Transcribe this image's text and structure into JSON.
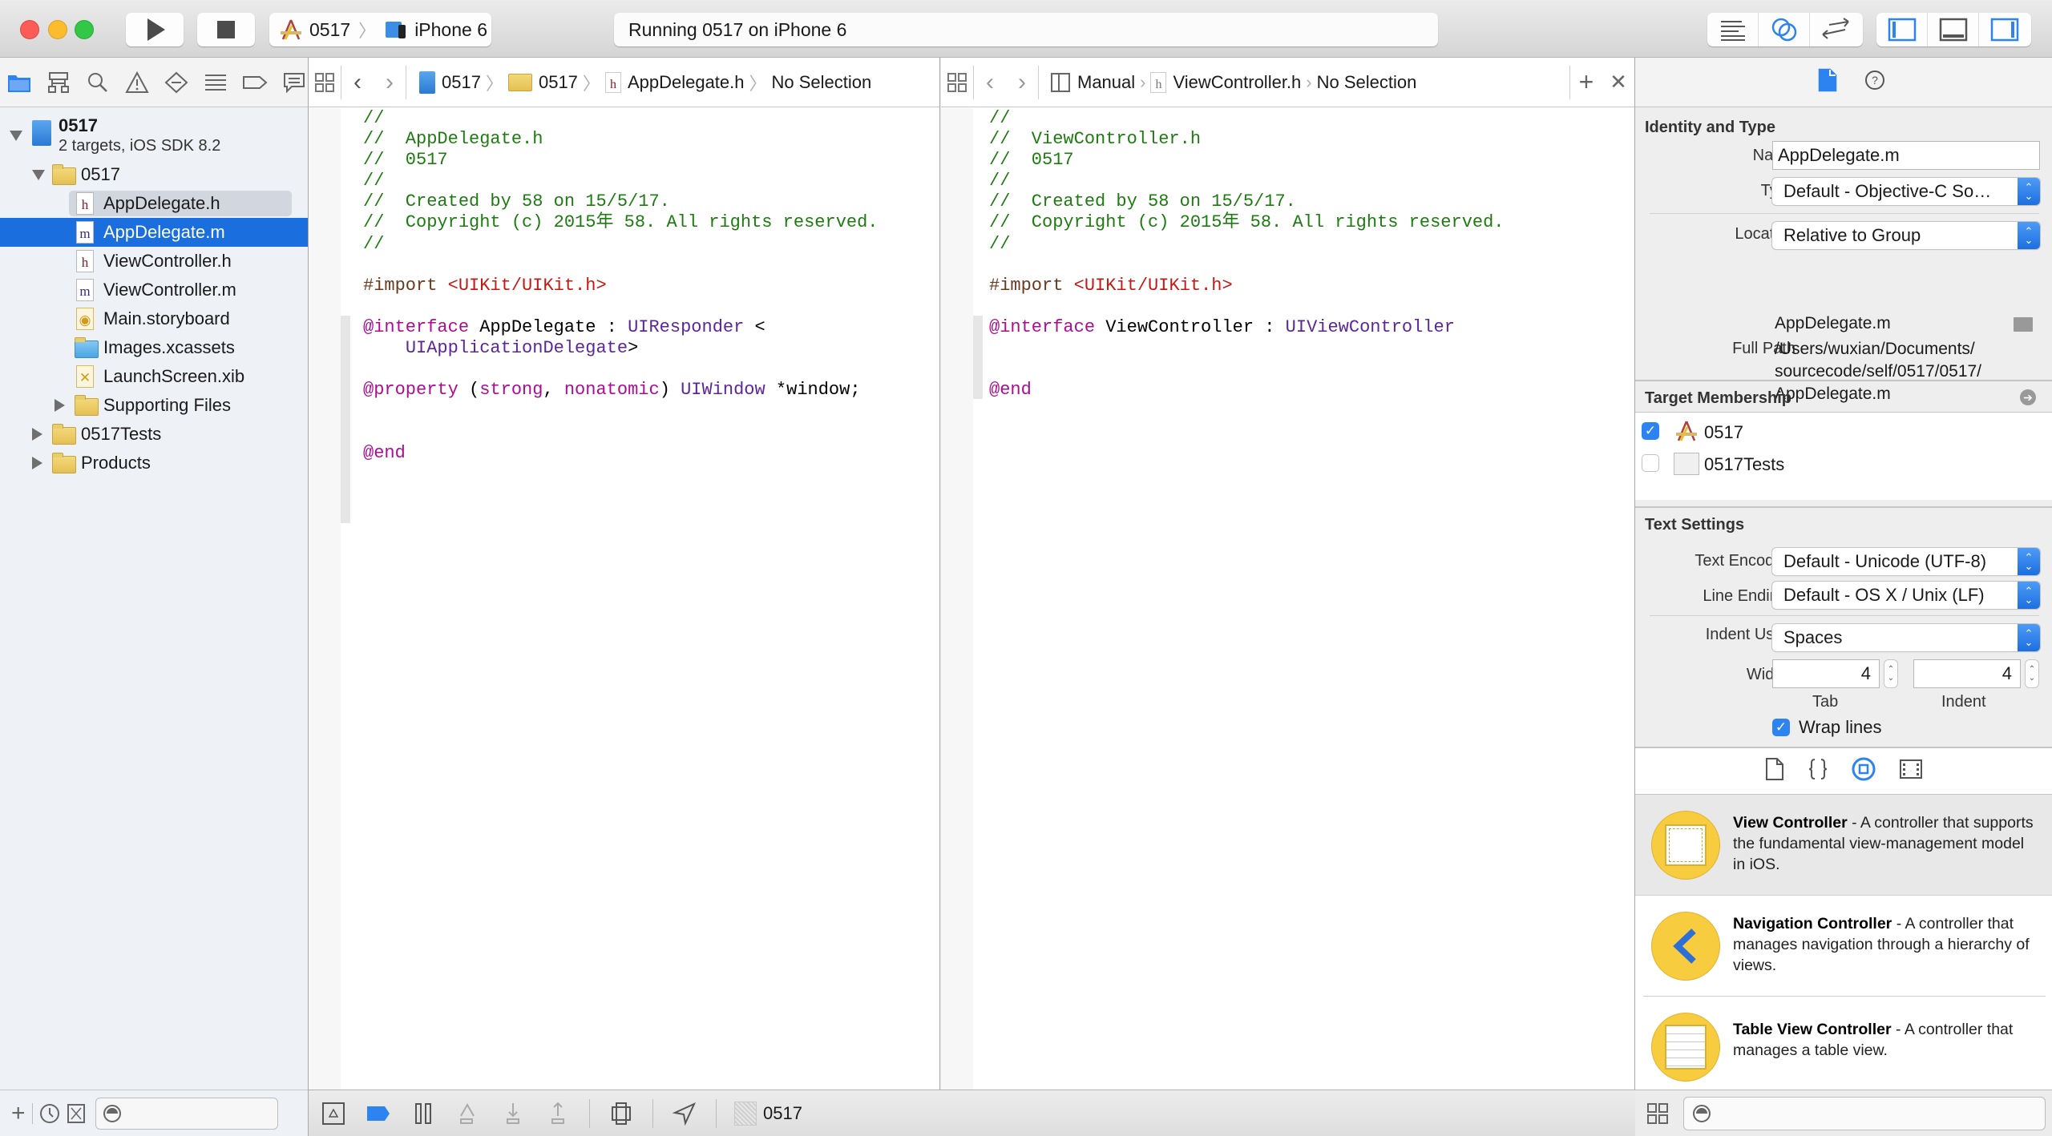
{
  "toolbar": {
    "scheme": "0517",
    "device": "iPhone 6",
    "status": "Running 0517 on iPhone 6",
    "icons": [
      "run-icon",
      "stop-icon",
      "standard-editor-icon",
      "assistant-editor-icon",
      "version-editor-icon",
      "navigator-toggle-icon",
      "debug-area-toggle-icon",
      "utilities-toggle-icon"
    ],
    "accent": "#2d83f0"
  },
  "navigator": {
    "tabs": [
      "project-navigator",
      "symbol-navigator",
      "find-navigator",
      "issue-navigator",
      "test-navigator",
      "debug-navigator",
      "breakpoint-navigator",
      "report-navigator"
    ],
    "project": {
      "name": "0517",
      "subtitle": "2 targets, iOS SDK 8.2"
    },
    "items": [
      {
        "label": "0517",
        "type": "folder",
        "level": 1,
        "state": "open"
      },
      {
        "label": "AppDelegate.h",
        "type": "h",
        "level": 2
      },
      {
        "label": "AppDelegate.m",
        "type": "m",
        "level": 2,
        "selected": true
      },
      {
        "label": "ViewController.h",
        "type": "h",
        "level": 2
      },
      {
        "label": "ViewController.m",
        "type": "m",
        "level": 2
      },
      {
        "label": "Main.storyboard",
        "type": "storyboard",
        "level": 2
      },
      {
        "label": "Images.xcassets",
        "type": "xcassets",
        "level": 2
      },
      {
        "label": "LaunchScreen.xib",
        "type": "xib",
        "level": 2
      },
      {
        "label": "Supporting Files",
        "type": "folder",
        "level": 2,
        "state": "closed"
      },
      {
        "label": "0517Tests",
        "type": "folder",
        "level": 1,
        "state": "closed"
      },
      {
        "label": "Products",
        "type": "folder",
        "level": 1,
        "state": "closed"
      }
    ],
    "filter_placeholder": ""
  },
  "editor_left": {
    "jumpbar": {
      "project": "0517",
      "group": "0517",
      "file": "AppDelegate.h",
      "selection": "No Selection"
    },
    "lines": {
      "l1": "//",
      "l2": "//  AppDelegate.h",
      "l3": "//  0517",
      "l4": "//",
      "l5": "//  Created by 58 on 15/5/17.",
      "l6": "//  Copyright (c) 2015年 58. All rights reserved.",
      "l7": "//",
      "import_kw": "#import",
      "import_path": "<UIKit/UIKit.h>",
      "iface_kw": "@interface",
      "iface_name": " AppDelegate : ",
      "iface_super": "UIResponder",
      "iface_lt": " <",
      "iface_proto": "UIApplicationDelegate",
      "iface_gt": ">",
      "prop_kw": "@property",
      "prop_open": " (",
      "prop_strong": "strong",
      "prop_comma": ", ",
      "prop_nonatomic": "nonatomic",
      "prop_close": ") ",
      "prop_type": "UIWindow",
      "prop_var": " *window;",
      "end_kw": "@end"
    }
  },
  "editor_right": {
    "jumpbar": {
      "mode": "Manual",
      "file": "ViewController.h",
      "selection": "No Selection"
    },
    "lines": {
      "l1": "//",
      "l2": "//  ViewController.h",
      "l3": "//  0517",
      "l4": "//",
      "l5": "//  Created by 58 on 15/5/17.",
      "l6": "//  Copyright (c) 2015年 58. All rights reserved.",
      "l7": "//",
      "import_kw": "#import",
      "import_path": "<UIKit/UIKit.h>",
      "iface_kw": "@interface",
      "iface_name": " ViewController : ",
      "iface_super": "UIViewController",
      "end_kw": "@end"
    }
  },
  "debugbar": {
    "target": "0517"
  },
  "inspector": {
    "identity": {
      "title": "Identity and Type",
      "name_label": "Name",
      "name_value": "AppDelegate.m",
      "type_label": "Type",
      "type_value": "Default - Objective-C So…",
      "location_label": "Location",
      "location_value": "Relative to Group",
      "relative_path": "AppDelegate.m",
      "fullpath_label": "Full Path",
      "fullpath_1": "/Users/wuxian/Documents/",
      "fullpath_2": "sourcecode/self/0517/0517/",
      "fullpath_3": "AppDelegate.m"
    },
    "membership": {
      "title": "Target Membership",
      "targets": [
        {
          "name": "0517",
          "checked": true
        },
        {
          "name": "0517Tests",
          "checked": false
        }
      ]
    },
    "text_settings": {
      "title": "Text Settings",
      "encoding_label": "Text Encoding",
      "encoding_value": "Default - Unicode (UTF-8)",
      "endings_label": "Line Endings",
      "endings_value": "Default - OS X / Unix (LF)",
      "indent_label": "Indent Using",
      "indent_value": "Spaces",
      "widths_label": "Widths",
      "tab_value": "4",
      "tab_label": "Tab",
      "indent_width_value": "4",
      "indent_width_label": "Indent",
      "wrap_label": "Wrap lines",
      "wrap_checked": true
    },
    "library": {
      "tabs": [
        "file-template-library",
        "code-snippet-library",
        "object-library",
        "media-library"
      ],
      "active_tab": "object-library",
      "items": [
        {
          "title": "View Controller",
          "desc": " - A controller that supports the fundamental view-management model in iOS."
        },
        {
          "title": "Navigation Controller",
          "desc": " - A controller that manages navigation through a hierarchy of views."
        },
        {
          "title": "Table View Controller",
          "desc": " - A controller that manages a table view."
        }
      ]
    }
  }
}
